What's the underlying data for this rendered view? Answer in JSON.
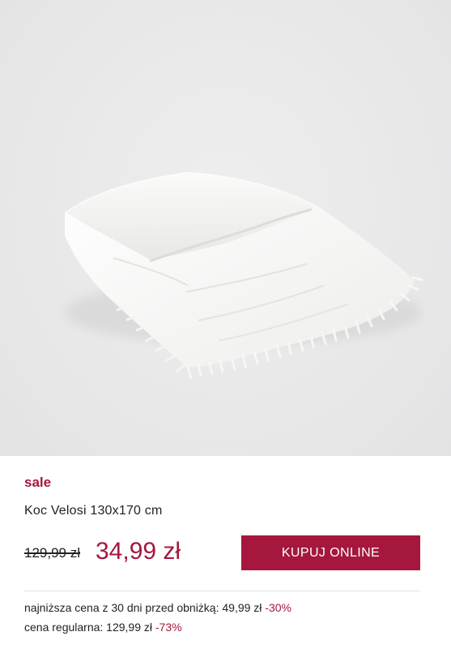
{
  "product": {
    "image_alt": "Koc Velosi 130x170 cm",
    "badge": "sale",
    "name": "Koc Velosi 130x170 cm",
    "old_price": "129,99 zł",
    "new_price": "34,99 zł",
    "buy_label": "KUPUJ ONLINE",
    "lowest_price_text": "najniższa cena z 30 dni przed obniżką: 49,99 zł",
    "lowest_price_discount": "-30%",
    "regular_price_text": "cena regularna: 129,99 zł",
    "regular_price_discount": "-73%"
  },
  "colors": {
    "accent": "#a5173d",
    "image_background": "#e8e8e9"
  }
}
